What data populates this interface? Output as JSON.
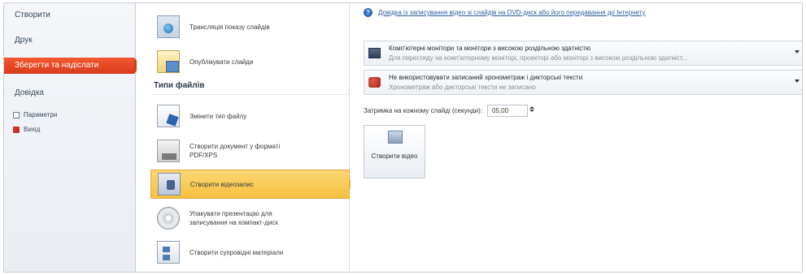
{
  "nav": {
    "items": [
      {
        "label": "Створити"
      },
      {
        "label": "Друк"
      },
      {
        "label": "Зберегти та надіслати"
      },
      {
        "label": "Довідка"
      }
    ],
    "sub": [
      {
        "label": "Параметри"
      },
      {
        "label": "Вихід"
      }
    ]
  },
  "middle": {
    "options_top": [
      {
        "label": "Трансляція показу слайдів"
      },
      {
        "label": "Опублікувати слайди"
      }
    ],
    "section_title": "Типи файлів",
    "options_files": [
      {
        "label": "Змінити тип файлу"
      },
      {
        "label": "Створити документ у форматі PDF/XPS"
      },
      {
        "label": "Створити відеозапис"
      },
      {
        "label": "Упакувати презентацію для записування на компакт-диск"
      },
      {
        "label": "Створити супровідні матеріали"
      }
    ]
  },
  "right": {
    "help_link": "Довідка із записування відео зі слайдів на DVD-диск або його передавання до Інтернету",
    "quality": {
      "title": "Комп'ютерні монітори та монітори з високою роздільною здатністю",
      "desc": "Для перегляду на комп'ютерному моніторі, проекторі або моніторі з високою роздільною здатніст..."
    },
    "timing": {
      "title": "Не використовувати записаний хронометраж і дикторські тексти",
      "desc": "Хронометраж або дикторські тексти не записано"
    },
    "delay_label": "Затримка на кожному слайді (секунди):",
    "delay_value": "05,00",
    "create_button": "Створити відео"
  }
}
